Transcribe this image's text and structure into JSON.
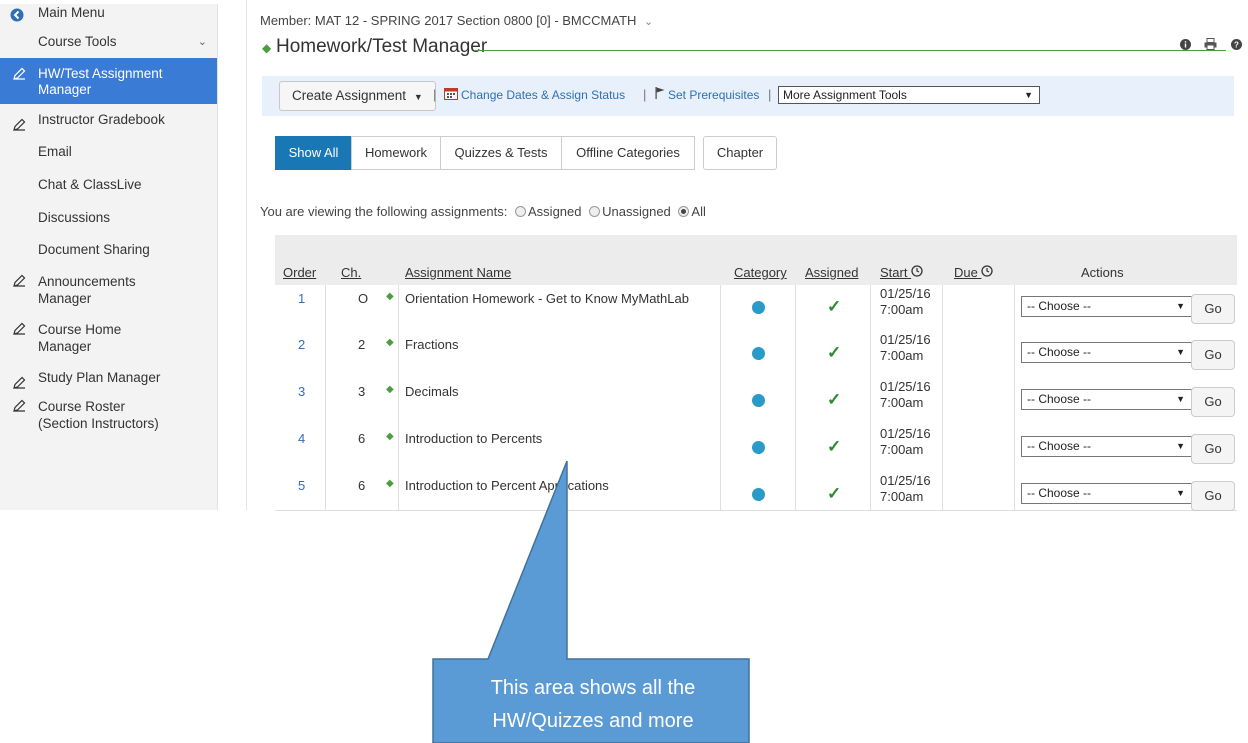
{
  "sidebar": {
    "items": [
      {
        "label": "Main Menu",
        "icon": "left-circle-icon"
      },
      {
        "label": "Course Tools",
        "icon": ""
      },
      {
        "label": "HW/Test Assignment Manager",
        "line1": "HW/Test Assignment",
        "line2": "Manager",
        "icon": "pencil-icon",
        "active": true
      },
      {
        "label": "Instructor Gradebook",
        "icon": "pencil-icon"
      },
      {
        "label": "Email",
        "icon": ""
      },
      {
        "label": "Chat & ClassLive",
        "icon": ""
      },
      {
        "label": "Discussions",
        "icon": ""
      },
      {
        "label": "Document Sharing",
        "icon": ""
      },
      {
        "label": "Announcements Manager",
        "line1": "Announcements",
        "line2": "Manager",
        "icon": "pencil-icon"
      },
      {
        "label": "Course Home Manager",
        "line1": "Course Home",
        "line2": "Manager",
        "icon": "pencil-icon"
      },
      {
        "label": "Study Plan Manager",
        "icon": "pencil-icon"
      },
      {
        "label": "Course Roster (Section Instructors)",
        "line1": "Course Roster",
        "line2": "(Section Instructors)",
        "icon": "pencil-icon"
      }
    ]
  },
  "header": {
    "member": "Member: MAT 12 - SPRING 2017 Section 0800 [0] - BMCCMATH",
    "title": "Homework/Test Manager"
  },
  "toolbar": {
    "create": "Create Assignment",
    "change_dates": "Change Dates & Assign Status",
    "prereq": "Set Prerequisites",
    "more_tools": "More Assignment Tools"
  },
  "tabs": [
    "Show All",
    "Homework",
    "Quizzes & Tests",
    "Offline Categories",
    "Chapter"
  ],
  "viewing": {
    "prefix": "You are viewing the following assignments:",
    "options": [
      "Assigned",
      "Unassigned",
      "All"
    ]
  },
  "table": {
    "headers": {
      "order": "Order",
      "ch": "Ch.",
      "name": "Assignment Name",
      "category": "Category",
      "assigned": "Assigned",
      "start": "Start",
      "due": "Due",
      "actions": "Actions"
    },
    "rows": [
      {
        "order": "1",
        "ch": "O",
        "name": "Orientation Homework - Get to Know MyMathLab",
        "start_date": "01/25/16",
        "start_time": "7:00am",
        "due": "",
        "action": "-- Choose --",
        "go": "Go"
      },
      {
        "order": "2",
        "ch": "2",
        "name": "Fractions",
        "start_date": "01/25/16",
        "start_time": "7:00am",
        "due": "",
        "action": "-- Choose --",
        "go": "Go"
      },
      {
        "order": "3",
        "ch": "3",
        "name": "Decimals",
        "start_date": "01/25/16",
        "start_time": "7:00am",
        "due": "",
        "action": "-- Choose --",
        "go": "Go"
      },
      {
        "order": "4",
        "ch": "6",
        "name": "Introduction to Percents",
        "start_date": "01/25/16",
        "start_time": "7:00am",
        "due": "",
        "action": "-- Choose --",
        "go": "Go"
      },
      {
        "order": "5",
        "ch": "6",
        "name": "Introduction to Percent Applications",
        "start_date": "01/25/16",
        "start_time": "7:00am",
        "due": "",
        "action": "-- Choose --",
        "go": "Go"
      }
    ]
  },
  "callout": {
    "line1": "This area shows all the",
    "line2": "HW/Quizzes and more"
  },
  "colors": {
    "active_sidebar": "#3a7bd5",
    "active_tab": "#1a77b6",
    "accent_green": "#4a9e3f",
    "category_dot": "#2a9ac9",
    "callout_fill": "#5b9bd5"
  }
}
